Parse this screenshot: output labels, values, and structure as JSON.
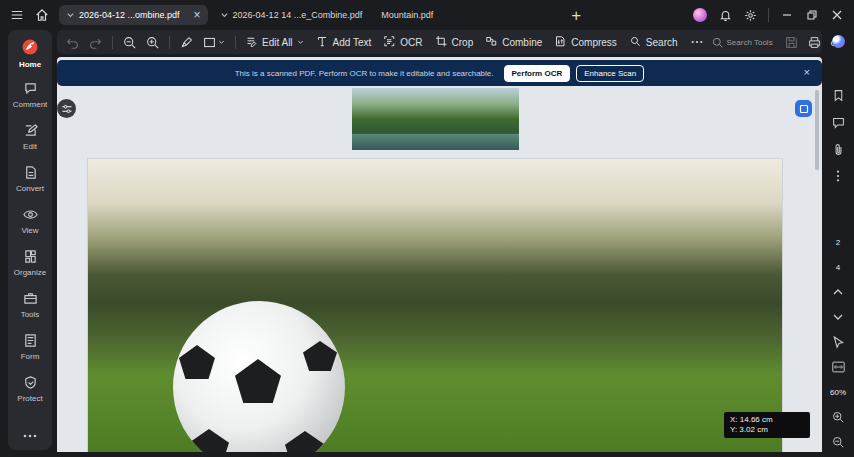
{
  "tabs": [
    {
      "label": "2026-04-12 ...ombine.pdf",
      "selected": true
    },
    {
      "label": "2026-04-12 14 ...e_Combine.pdf",
      "selected": false
    },
    {
      "label": "Mountain.pdf",
      "selected": false
    }
  ],
  "tab_close": "×",
  "new_tab": "+",
  "toolbar": {
    "items": [
      "Edit All",
      "Add Text",
      "OCR",
      "Crop",
      "Combine",
      "Compress",
      "Search"
    ],
    "search_tools": "Search Tools"
  },
  "sidebar": {
    "items": [
      {
        "label": "Home",
        "selected": true
      },
      {
        "label": "Comment",
        "selected": false
      },
      {
        "label": "Edit",
        "selected": false
      },
      {
        "label": "Convert",
        "selected": false
      },
      {
        "label": "View",
        "selected": false
      },
      {
        "label": "Organize",
        "selected": false
      },
      {
        "label": "Tools",
        "selected": false
      },
      {
        "label": "Form",
        "selected": false
      },
      {
        "label": "Protect",
        "selected": false
      }
    ]
  },
  "banner": {
    "message": "This is a scanned PDF. Perform OCR to make it editable and searchable.",
    "buttons": [
      "Perform OCR",
      "Enhance Scan"
    ],
    "close": "×"
  },
  "page_nav": {
    "pages": [
      "2",
      "4"
    ],
    "zoom": "60%"
  },
  "coordinates": {
    "x": "X: 14.66 cm",
    "y": "Y: 3.02 cm"
  }
}
